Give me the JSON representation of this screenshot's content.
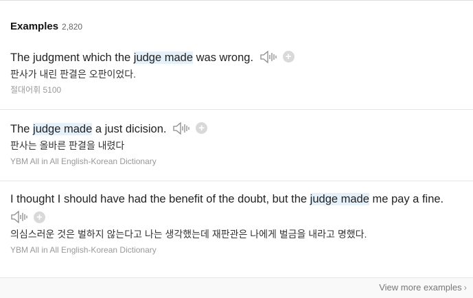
{
  "section": {
    "title": "Examples",
    "count": "2,820"
  },
  "examples": [
    {
      "before": "The judgment which the ",
      "highlight": "judge made",
      "after": " was wrong.",
      "translation": "판사가 내린 판결은 오판이었다.",
      "source": "절대어휘 5100"
    },
    {
      "before": "The ",
      "highlight": "judge made",
      "after": " a just dicision.",
      "translation": "판사는 올바른 판결을 내렸다",
      "source": "YBM All in All English-Korean Dictionary"
    },
    {
      "before": "I thought I should have had the benefit of the doubt, but the ",
      "highlight": "judge made",
      "after": " me pay a fine.",
      "translation": "의심스러운 것은 벌하지 않는다고 나는 생각했는데 재판관은 나에게 벌금을 내라고 명했다.",
      "source": "YBM All in All English-Korean Dictionary"
    }
  ],
  "footer": {
    "view_more": "View more examples"
  },
  "icons": {
    "speaker": "speaker-icon",
    "add": "plus-circle-icon",
    "more": "chevron-right-icon"
  },
  "colors": {
    "highlight": "#e4f1fb",
    "source_text": "#999999",
    "add_button": "#d9d9d9"
  }
}
